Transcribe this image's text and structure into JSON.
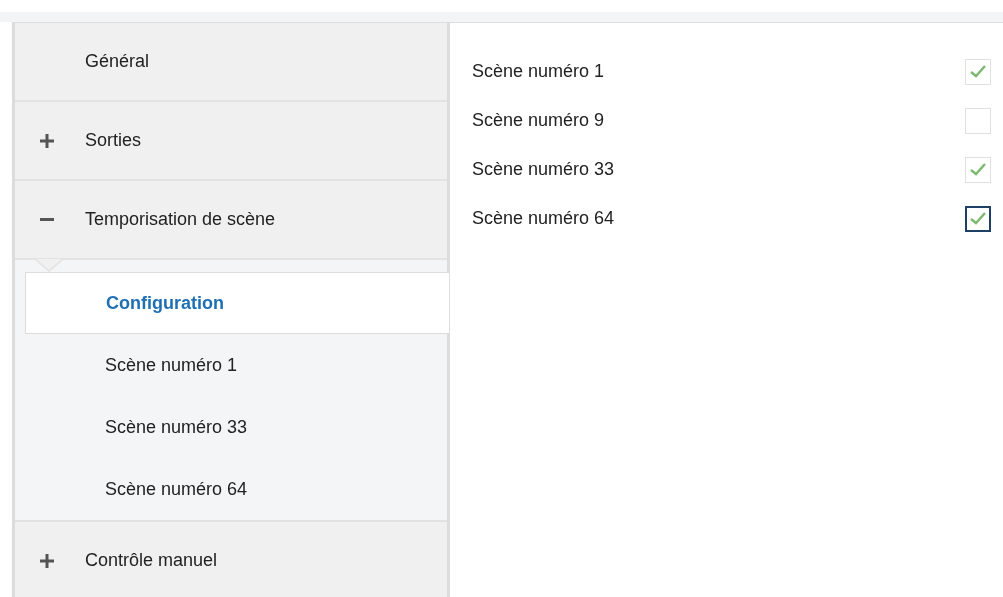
{
  "sidebar": {
    "items": [
      {
        "kind": "leaf",
        "label": "Général"
      },
      {
        "kind": "group",
        "label": "Sorties",
        "expanded": false
      },
      {
        "kind": "group",
        "label": "Temporisation de scène",
        "expanded": true,
        "children": [
          {
            "label": "Configuration",
            "selected": true
          },
          {
            "label": "Scène numéro 1",
            "selected": false
          },
          {
            "label": "Scène numéro 33",
            "selected": false
          },
          {
            "label": "Scène numéro 64",
            "selected": false
          }
        ]
      },
      {
        "kind": "group",
        "label": "Contrôle manuel",
        "expanded": false
      }
    ]
  },
  "settings": [
    {
      "label": "Scène numéro 1",
      "checked": true,
      "focused": false
    },
    {
      "label": "Scène numéro 9",
      "checked": false,
      "focused": false
    },
    {
      "label": "Scène numéro 33",
      "checked": true,
      "focused": false
    },
    {
      "label": "Scène numéro 64",
      "checked": true,
      "focused": true
    }
  ]
}
